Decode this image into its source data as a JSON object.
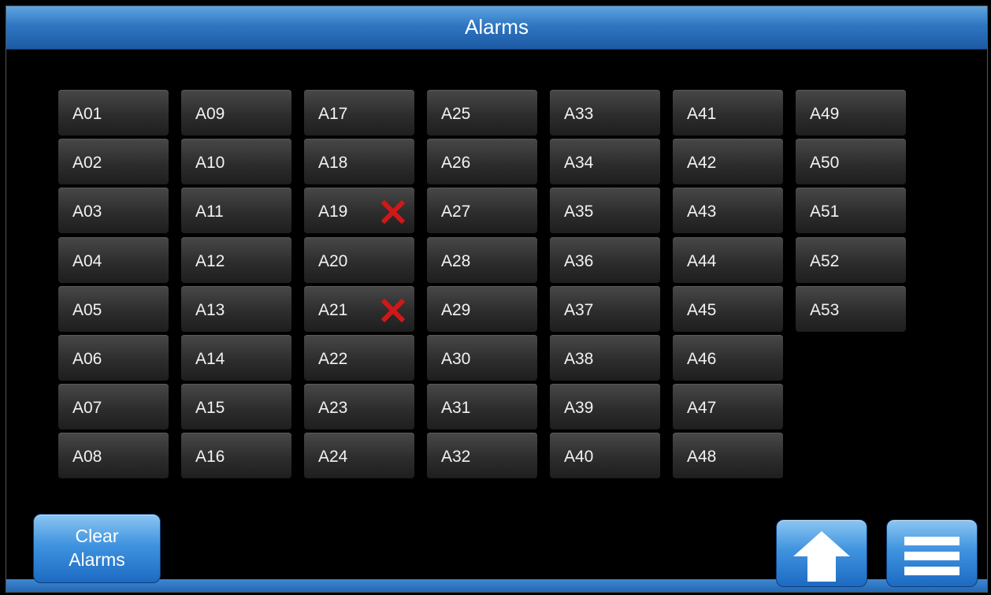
{
  "header": {
    "title": "Alarms"
  },
  "alarms": {
    "columns": [
      [
        {
          "id": "A01",
          "active": false
        },
        {
          "id": "A02",
          "active": false
        },
        {
          "id": "A03",
          "active": false
        },
        {
          "id": "A04",
          "active": false
        },
        {
          "id": "A05",
          "active": false
        },
        {
          "id": "A06",
          "active": false
        },
        {
          "id": "A07",
          "active": false
        },
        {
          "id": "A08",
          "active": false
        }
      ],
      [
        {
          "id": "A09",
          "active": false
        },
        {
          "id": "A10",
          "active": false
        },
        {
          "id": "A11",
          "active": false
        },
        {
          "id": "A12",
          "active": false
        },
        {
          "id": "A13",
          "active": false
        },
        {
          "id": "A14",
          "active": false
        },
        {
          "id": "A15",
          "active": false
        },
        {
          "id": "A16",
          "active": false
        }
      ],
      [
        {
          "id": "A17",
          "active": false
        },
        {
          "id": "A18",
          "active": false
        },
        {
          "id": "A19",
          "active": true
        },
        {
          "id": "A20",
          "active": false
        },
        {
          "id": "A21",
          "active": true
        },
        {
          "id": "A22",
          "active": false
        },
        {
          "id": "A23",
          "active": false
        },
        {
          "id": "A24",
          "active": false
        }
      ],
      [
        {
          "id": "A25",
          "active": false
        },
        {
          "id": "A26",
          "active": false
        },
        {
          "id": "A27",
          "active": false
        },
        {
          "id": "A28",
          "active": false
        },
        {
          "id": "A29",
          "active": false
        },
        {
          "id": "A30",
          "active": false
        },
        {
          "id": "A31",
          "active": false
        },
        {
          "id": "A32",
          "active": false
        }
      ],
      [
        {
          "id": "A33",
          "active": false
        },
        {
          "id": "A34",
          "active": false
        },
        {
          "id": "A35",
          "active": false
        },
        {
          "id": "A36",
          "active": false
        },
        {
          "id": "A37",
          "active": false
        },
        {
          "id": "A38",
          "active": false
        },
        {
          "id": "A39",
          "active": false
        },
        {
          "id": "A40",
          "active": false
        }
      ],
      [
        {
          "id": "A41",
          "active": false
        },
        {
          "id": "A42",
          "active": false
        },
        {
          "id": "A43",
          "active": false
        },
        {
          "id": "A44",
          "active": false
        },
        {
          "id": "A45",
          "active": false
        },
        {
          "id": "A46",
          "active": false
        },
        {
          "id": "A47",
          "active": false
        },
        {
          "id": "A48",
          "active": false
        }
      ],
      [
        {
          "id": "A49",
          "active": false
        },
        {
          "id": "A50",
          "active": false
        },
        {
          "id": "A51",
          "active": false
        },
        {
          "id": "A52",
          "active": false
        },
        {
          "id": "A53",
          "active": false
        }
      ]
    ],
    "active_marker_icon": "x-icon",
    "active_marker_color": "#d01818"
  },
  "footer": {
    "clear_button": {
      "line1": "Clear",
      "line2": "Alarms"
    },
    "home_button_icon": "up-arrow-icon",
    "menu_button_icon": "hamburger-menu-icon"
  },
  "colors": {
    "accent_blue": "#2e76c2",
    "background": "#000000",
    "alarm_tile": "#2d2d2d"
  }
}
